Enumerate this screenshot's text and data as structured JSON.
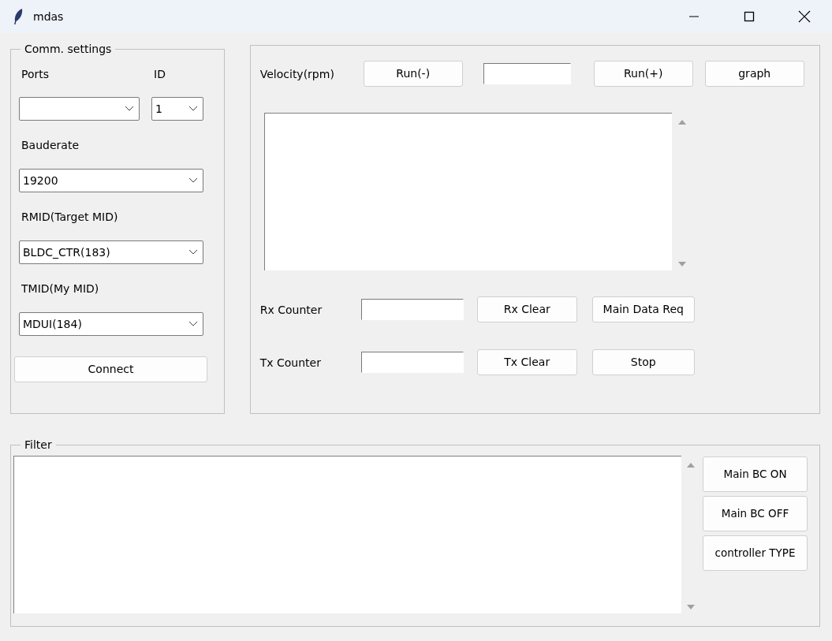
{
  "window": {
    "title": "mdas"
  },
  "comm_settings": {
    "legend": "Comm. settings",
    "ports_label": "Ports",
    "id_label": "ID",
    "id_value": "1",
    "combos": [
      {
        "label": "Bauderate",
        "value": "19200"
      },
      {
        "label": "RMID(Target MID)",
        "value": "BLDC_CTR(183)"
      },
      {
        "label": "TMID(My MID)",
        "value": "MDUI(184)"
      }
    ],
    "connect_button": "Connect"
  },
  "control": {
    "velocity_label": "Velocity(rpm)",
    "run_minus_button": "Run(-)",
    "run_plus_button": "Run(+)",
    "graph_button": "graph",
    "counters": [
      {
        "label": "Rx Counter",
        "clear_button": "Rx Clear",
        "action_button": "Main Data Req"
      },
      {
        "label": "Tx Counter",
        "clear_button": "Tx Clear",
        "action_button": "Stop"
      }
    ]
  },
  "filter": {
    "legend": "Filter",
    "buttons": [
      "Main BC ON",
      "Main BC OFF",
      "controller TYPE"
    ]
  }
}
